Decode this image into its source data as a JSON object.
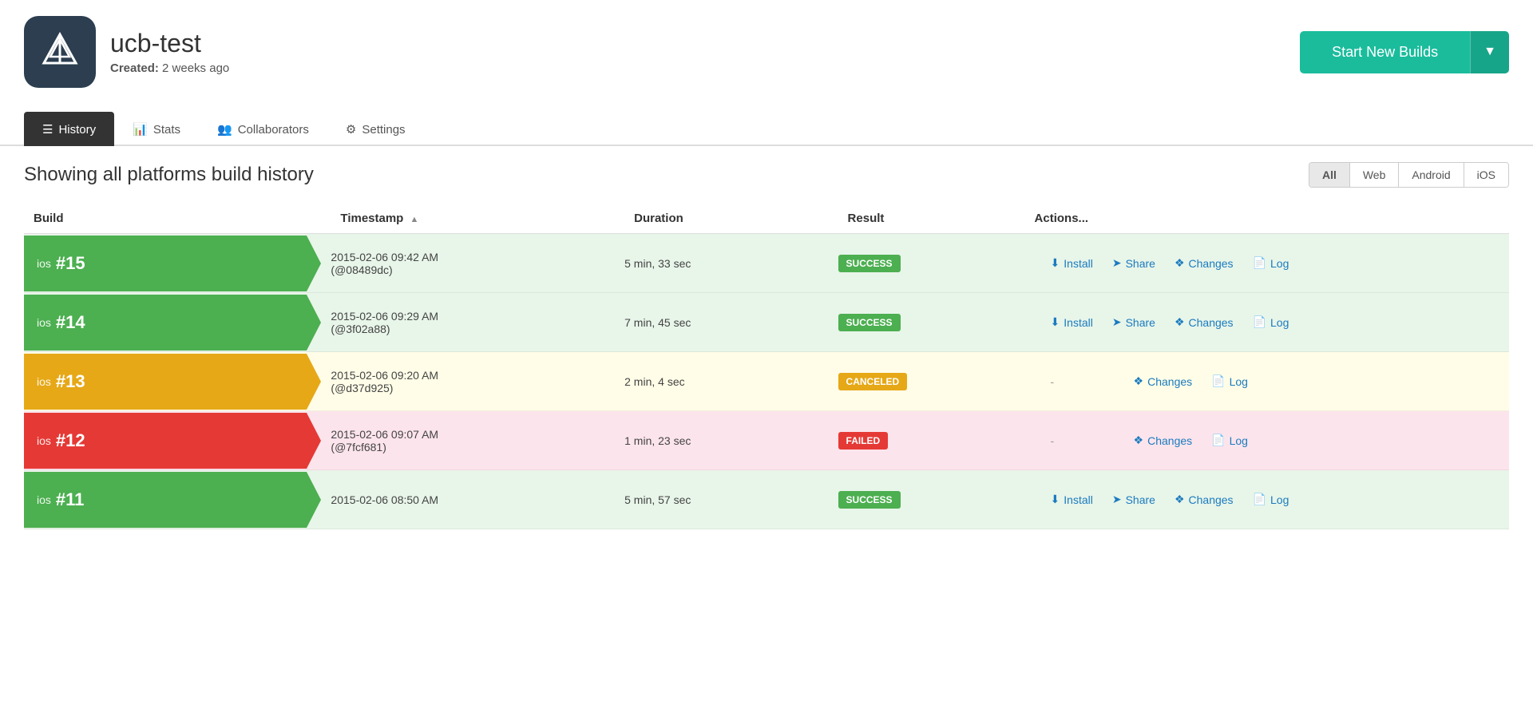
{
  "header": {
    "project_name": "ucb-test",
    "created_label": "Created:",
    "created_value": "2 weeks ago"
  },
  "toolbar": {
    "start_builds_label": "Start New Builds",
    "dropdown_arrow": "▼"
  },
  "tabs": [
    {
      "id": "history",
      "label": "History",
      "icon": "list-icon",
      "active": true
    },
    {
      "id": "stats",
      "label": "Stats",
      "icon": "stats-icon",
      "active": false
    },
    {
      "id": "collaborators",
      "label": "Collaborators",
      "icon": "collaborators-icon",
      "active": false
    },
    {
      "id": "settings",
      "label": "Settings",
      "icon": "settings-icon",
      "active": false
    }
  ],
  "history": {
    "title": "Showing all platforms build history",
    "filters": [
      "All",
      "Web",
      "Android",
      "iOS"
    ],
    "active_filter": "All",
    "columns": [
      "Build",
      "Timestamp",
      "Duration",
      "Result",
      "Actions..."
    ],
    "rows": [
      {
        "id": 15,
        "platform": "ios",
        "label": "#15",
        "timestamp": "2015-02-06 09:42 AM\n(@08489dc)",
        "duration": "5 min, 33 sec",
        "result": "SUCCESS",
        "result_type": "success",
        "actions": [
          "Install",
          "Share",
          "Changes",
          "Log"
        ]
      },
      {
        "id": 14,
        "platform": "ios",
        "label": "#14",
        "timestamp": "2015-02-06 09:29 AM\n(@3f02a88)",
        "duration": "7 min, 45 sec",
        "result": "SUCCESS",
        "result_type": "success",
        "actions": [
          "Install",
          "Share",
          "Changes",
          "Log"
        ]
      },
      {
        "id": 13,
        "platform": "ios",
        "label": "#13",
        "timestamp": "2015-02-06 09:20 AM\n(@d37d925)",
        "duration": "2 min, 4 sec",
        "result": "CANCELED",
        "result_type": "canceled",
        "actions": [
          "Changes",
          "Log"
        ]
      },
      {
        "id": 12,
        "platform": "ios",
        "label": "#12",
        "timestamp": "2015-02-06 09:07 AM\n(@7fcf681)",
        "duration": "1 min, 23 sec",
        "result": "FAILED",
        "result_type": "failed",
        "actions": [
          "Changes",
          "Log"
        ]
      },
      {
        "id": 11,
        "platform": "ios",
        "label": "#11",
        "timestamp": "2015-02-06 08:50 AM",
        "duration": "5 min, 57 sec",
        "result": "SUCCESS",
        "result_type": "success",
        "actions": [
          "Install",
          "Share",
          "Changes",
          "Log"
        ]
      }
    ]
  },
  "icons": {
    "list": "☰",
    "stats": "📊",
    "collaborators": "👥",
    "settings": "⚙",
    "install": "⬇",
    "share": "➤",
    "changes": "❖",
    "log": "📄",
    "sort_asc": "▲"
  }
}
